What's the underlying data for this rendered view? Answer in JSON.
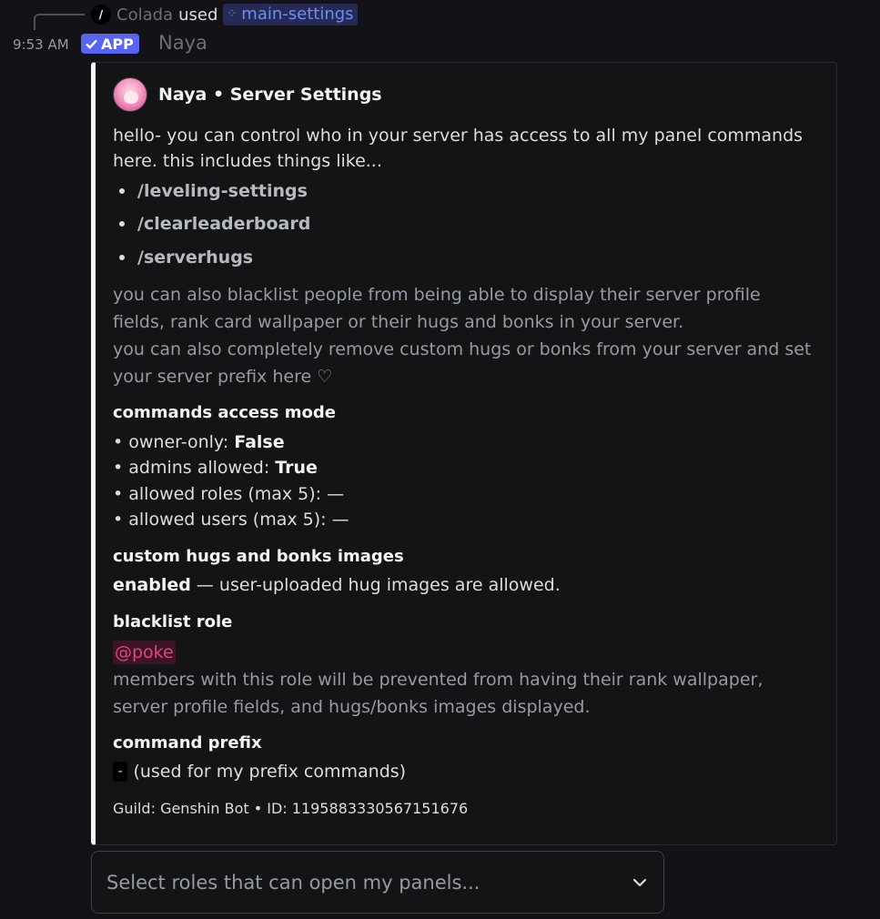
{
  "reply": {
    "command_icon": "/",
    "user": "Colada",
    "verb": "used",
    "command": "main-settings"
  },
  "message": {
    "timestamp": "9:53 AM",
    "app_badge": "APP",
    "author": "Naya"
  },
  "embed": {
    "author": "Naya • Server Settings",
    "intro": "hello- you can control who in your server has access to all my panel commands here. this includes things like...",
    "commands": [
      "/leveling-settings",
      "/clearleaderboard",
      "/serverhugs"
    ],
    "note1": "you can also blacklist people from being able to display their server profile fields, rank card wallpaper or their hugs and bonks in your server.",
    "note2": "you can also completely remove custom hugs or bonks from your server and set your server prefix here ♡",
    "access": {
      "title": "commands access mode",
      "owner_label": "• owner-only: ",
      "owner_value": "False",
      "admins_label": "• admins allowed: ",
      "admins_value": "True",
      "roles_line": "• allowed roles (max 5): —",
      "users_line": "• allowed users (max 5): —"
    },
    "custom_images": {
      "title": "custom hugs and bonks images",
      "status": "enabled",
      "desc": " — user-uploaded hug images are allowed."
    },
    "blacklist": {
      "title": "blacklist role",
      "role": "@poke",
      "desc": "members with this role will be prevented from having their rank wallpaper, server profile fields, and hugs/bonks images displayed."
    },
    "prefix": {
      "title": "command prefix",
      "value": "-",
      "desc": "(used for my prefix commands)"
    },
    "footer": "Guild: Genshin Bot • ID: 1195883330567151676"
  },
  "select": {
    "placeholder": "Select roles that can open my panels..."
  },
  "colors": {
    "accent": "#5865f2",
    "mention": "#e2457e",
    "command_link": "#6a8ff5",
    "embed_bar": "#f2f3f5"
  }
}
